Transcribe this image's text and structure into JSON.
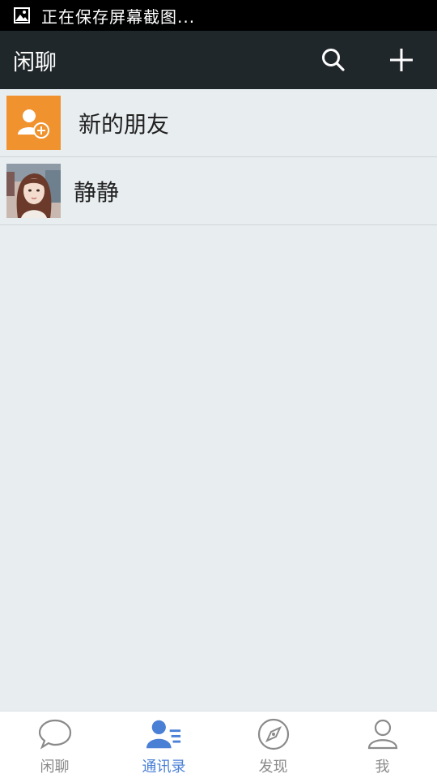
{
  "status_bar": {
    "text": "正在保存屏幕截图..."
  },
  "app_bar": {
    "title": "闲聊"
  },
  "contacts": [
    {
      "label": "新的朋友",
      "icon": "add-contact-icon",
      "color": "#f0922e"
    },
    {
      "label": "静静",
      "icon": "avatar-photo"
    }
  ],
  "tabs": [
    {
      "label": "闲聊",
      "icon": "chat-bubble-icon",
      "active": false
    },
    {
      "label": "通讯录",
      "icon": "contacts-icon",
      "active": true
    },
    {
      "label": "发现",
      "icon": "compass-icon",
      "active": false
    },
    {
      "label": "我",
      "icon": "person-icon",
      "active": false
    }
  ],
  "colors": {
    "status_bar_bg": "#000000",
    "app_bar_bg": "#20272b",
    "list_bg": "#e8edf0",
    "new_friend_icon_bg": "#f0922e",
    "tab_active": "#4a7fd6",
    "tab_inactive": "#8a8a8a"
  }
}
